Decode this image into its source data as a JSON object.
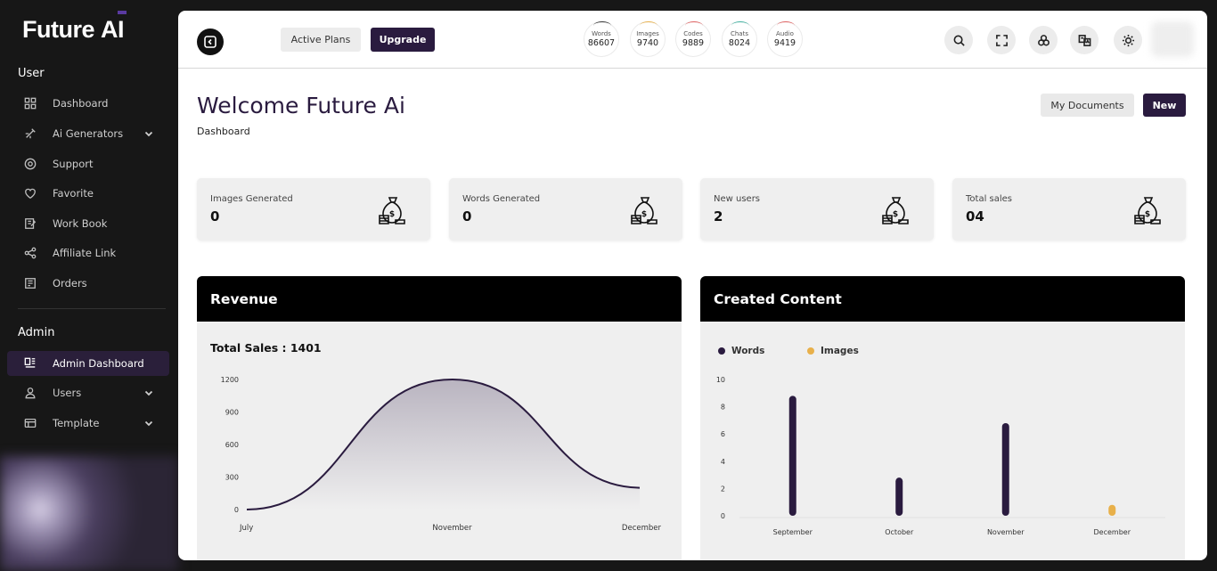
{
  "sidebar": {
    "logo": "Future",
    "logo_suffix": "AI",
    "user_section": "User",
    "admin_section": "Admin",
    "user_items": [
      {
        "label": "Dashboard",
        "icon": "grid-icon"
      },
      {
        "label": "Ai Generators",
        "icon": "ai-generators-icon",
        "expandable": true
      },
      {
        "label": "Support",
        "icon": "support-icon"
      },
      {
        "label": "Favorite",
        "icon": "heart-icon"
      },
      {
        "label": "Work Book",
        "icon": "workbook-icon"
      },
      {
        "label": "Affiliate Link",
        "icon": "share-icon"
      },
      {
        "label": "Orders",
        "icon": "orders-icon"
      }
    ],
    "admin_items": [
      {
        "label": "Admin Dashboard",
        "icon": "admin-dashboard-icon",
        "active": true
      },
      {
        "label": "Users",
        "icon": "user-icon",
        "expandable": true
      },
      {
        "label": "Template",
        "icon": "template-icon",
        "expandable": true
      }
    ]
  },
  "topbar": {
    "active_plans_label": "Active Plans",
    "upgrade_label": "Upgrade",
    "usage": [
      {
        "label": "Words",
        "value": "86607",
        "color": "#333333"
      },
      {
        "label": "Images",
        "value": "9740",
        "color": "#e8b04a"
      },
      {
        "label": "Codes",
        "value": "9889",
        "color": "#e06060"
      },
      {
        "label": "Chats",
        "value": "8024",
        "color": "#40b0a0"
      },
      {
        "label": "Audio",
        "value": "9419",
        "color": "#e06060"
      }
    ],
    "icons": [
      "search-icon",
      "fullscreen-icon",
      "settings-icon",
      "translate-icon",
      "theme-icon"
    ]
  },
  "header": {
    "title": "Welcome Future Ai",
    "breadcrumb": "Dashboard",
    "my_documents_label": "My Documents",
    "new_label": "New"
  },
  "stats": [
    {
      "label": "Images Generated",
      "value": "0"
    },
    {
      "label": "Words Generated",
      "value": "0"
    },
    {
      "label": "New users",
      "value": "2"
    },
    {
      "label": "Total sales",
      "value": "04"
    }
  ],
  "revenue": {
    "title": "Revenue",
    "total_sales": "Total Sales : 1401"
  },
  "created_content": {
    "title": "Created Content"
  },
  "colors": {
    "brand_dark": "#2a1b3f",
    "accent_orange": "#e8b04a"
  },
  "chart_data": [
    {
      "type": "area",
      "title": "Revenue",
      "x": [
        "July",
        "November",
        "December"
      ],
      "y": [
        0,
        1200,
        200
      ],
      "yticks": [
        0,
        300,
        600,
        900,
        1200
      ],
      "ylim": [
        0,
        1200
      ],
      "grid": false
    },
    {
      "type": "bar",
      "title": "Created Content",
      "categories": [
        "September",
        "October",
        "November",
        "December"
      ],
      "series": [
        {
          "name": "Words",
          "values": [
            8.8,
            2.8,
            6.8,
            0
          ],
          "color": "#2a1b3f"
        },
        {
          "name": "Images",
          "values": [
            0,
            0,
            0,
            0.8
          ],
          "color": "#e8b04a"
        }
      ],
      "yticks": [
        0,
        2,
        4,
        6,
        8,
        10
      ],
      "ylim": [
        0,
        10
      ],
      "legend": "top-left",
      "grid": false
    }
  ]
}
